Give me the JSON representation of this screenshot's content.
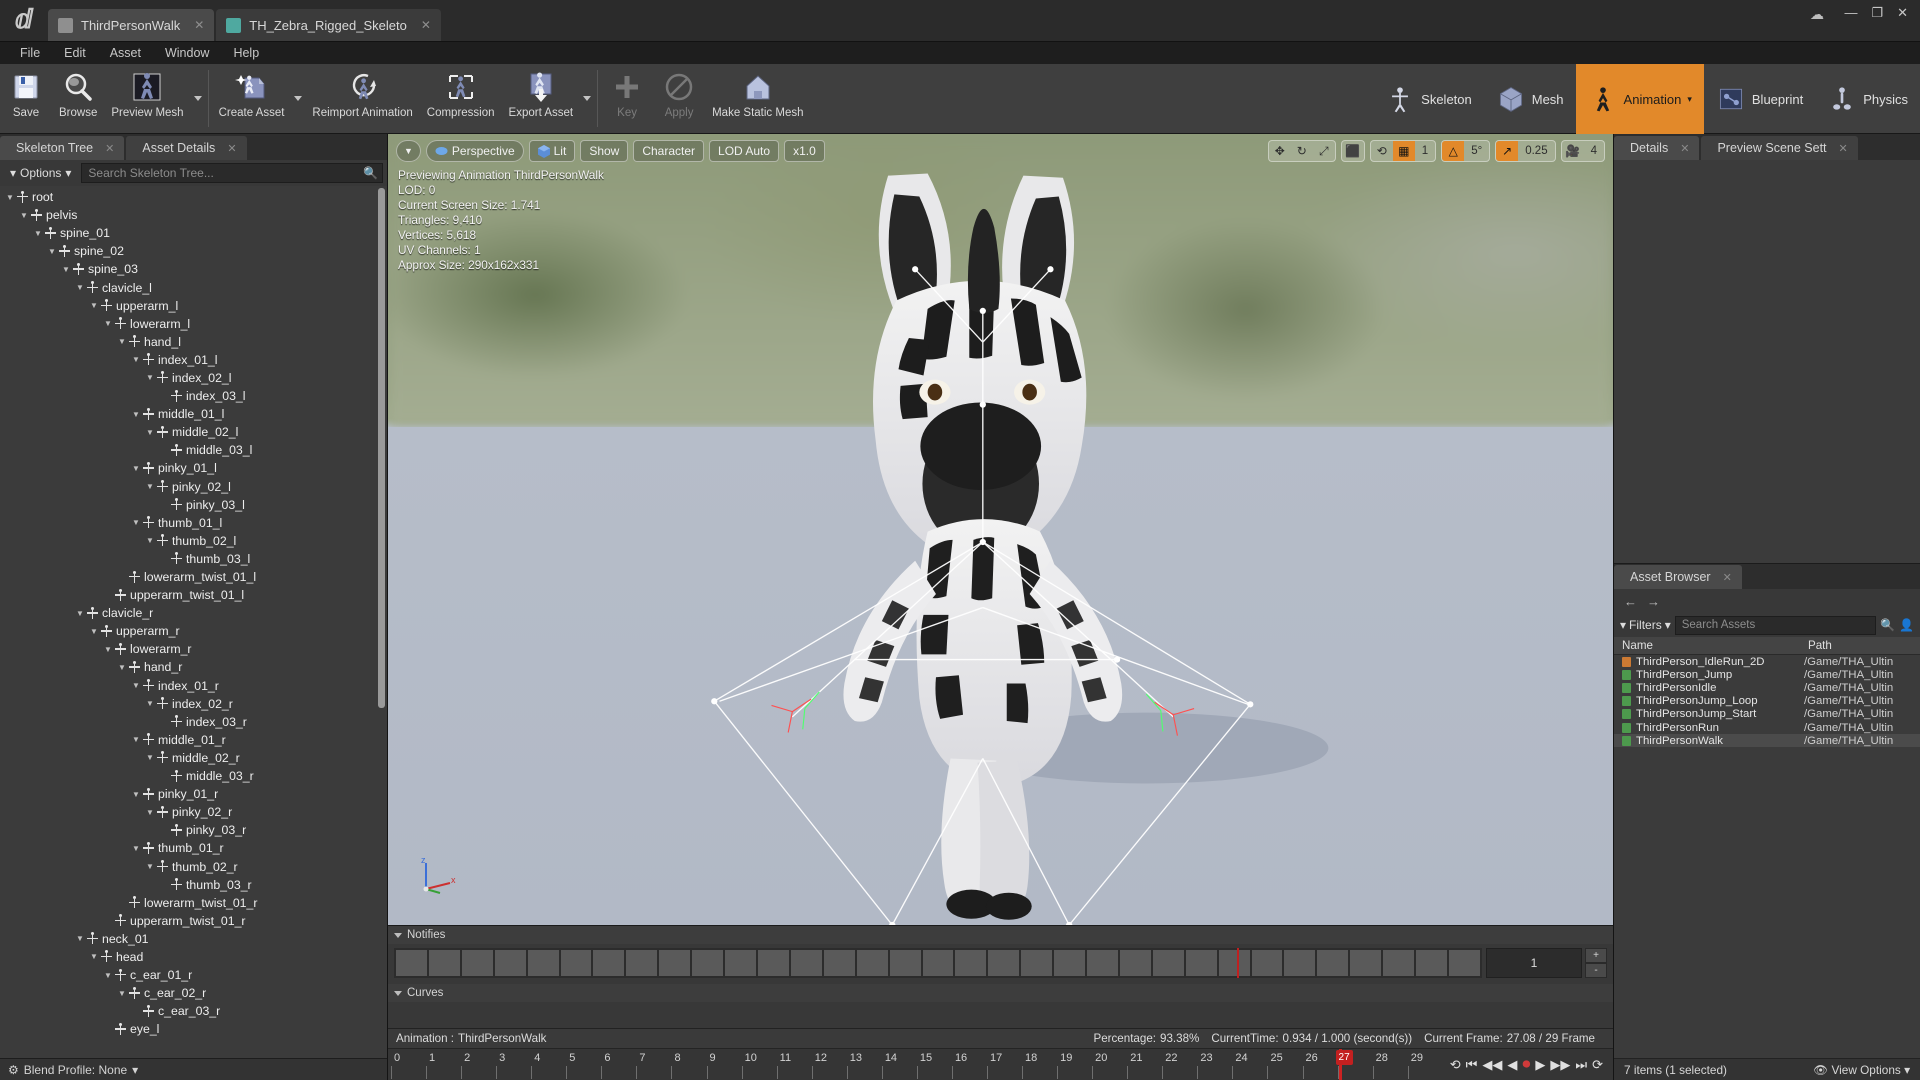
{
  "window": {
    "tabs": [
      {
        "label": "ThirdPersonWalk",
        "active": true,
        "icon": "animation-asset-icon",
        "color": "#8f8f8f"
      },
      {
        "label": "TH_Zebra_Rigged_Skeleto",
        "active": false,
        "icon": "skeleton-asset-icon",
        "color": "#4fa9a0"
      }
    ],
    "controls": {
      "minimize": "—",
      "maximize": "❐",
      "close": "✕",
      "cloud": "☁"
    }
  },
  "menubar": [
    "File",
    "Edit",
    "Asset",
    "Window",
    "Help"
  ],
  "toolbar": {
    "groups": [
      {
        "buttons": [
          {
            "label": "Save",
            "icon": "save-icon",
            "caret": false,
            "disabled": false
          },
          {
            "label": "Browse",
            "icon": "browse-magnifier-icon",
            "caret": false,
            "disabled": false
          },
          {
            "label": "Preview Mesh",
            "icon": "preview-mesh-icon",
            "caret": true,
            "disabled": false
          }
        ]
      },
      {
        "buttons": [
          {
            "label": "Create Asset",
            "icon": "create-asset-icon",
            "caret": true,
            "disabled": false
          },
          {
            "label": "Reimport Animation",
            "icon": "reimport-animation-icon",
            "caret": false,
            "disabled": false
          },
          {
            "label": "Compression",
            "icon": "compression-icon",
            "caret": false,
            "disabled": false
          },
          {
            "label": "Export Asset",
            "icon": "export-asset-icon",
            "caret": true,
            "disabled": false
          }
        ]
      },
      {
        "buttons": [
          {
            "label": "Key",
            "icon": "key-plus-icon",
            "caret": false,
            "disabled": true
          },
          {
            "label": "Apply",
            "icon": "apply-icon",
            "caret": false,
            "disabled": true
          },
          {
            "label": "Make Static Mesh",
            "icon": "make-static-mesh-icon",
            "caret": false,
            "disabled": false
          }
        ]
      }
    ],
    "modes": [
      {
        "label": "Skeleton",
        "selected": false,
        "caret": false,
        "icon": "skeleton-mode-icon"
      },
      {
        "label": "Mesh",
        "selected": false,
        "caret": false,
        "icon": "mesh-mode-icon"
      },
      {
        "label": "Animation",
        "selected": true,
        "caret": true,
        "icon": "animation-mode-icon"
      },
      {
        "label": "Blueprint",
        "selected": false,
        "caret": false,
        "icon": "blueprint-mode-icon"
      },
      {
        "label": "Physics",
        "selected": false,
        "caret": false,
        "icon": "physics-mode-icon"
      }
    ]
  },
  "left_panel": {
    "tabs": [
      {
        "label": "Skeleton Tree",
        "active": true,
        "icon": "skeleton-tree-icon"
      },
      {
        "label": "Asset Details",
        "active": false,
        "icon": "asset-details-icon"
      }
    ],
    "options_label": "Options",
    "search_placeholder": "Search Skeleton Tree...",
    "blend_profile_label": "Blend Profile: None",
    "bones": [
      {
        "name": "root",
        "depth": 0,
        "expandable": true
      },
      {
        "name": "pelvis",
        "depth": 1,
        "expandable": true
      },
      {
        "name": "spine_01",
        "depth": 2,
        "expandable": true
      },
      {
        "name": "spine_02",
        "depth": 3,
        "expandable": true
      },
      {
        "name": "spine_03",
        "depth": 4,
        "expandable": true
      },
      {
        "name": "clavicle_l",
        "depth": 5,
        "expandable": true
      },
      {
        "name": "upperarm_l",
        "depth": 6,
        "expandable": true
      },
      {
        "name": "lowerarm_l",
        "depth": 7,
        "expandable": true
      },
      {
        "name": "hand_l",
        "depth": 8,
        "expandable": true
      },
      {
        "name": "index_01_l",
        "depth": 9,
        "expandable": true
      },
      {
        "name": "index_02_l",
        "depth": 10,
        "expandable": true
      },
      {
        "name": "index_03_l",
        "depth": 11,
        "expandable": false
      },
      {
        "name": "middle_01_l",
        "depth": 9,
        "expandable": true
      },
      {
        "name": "middle_02_l",
        "depth": 10,
        "expandable": true
      },
      {
        "name": "middle_03_l",
        "depth": 11,
        "expandable": false
      },
      {
        "name": "pinky_01_l",
        "depth": 9,
        "expandable": true
      },
      {
        "name": "pinky_02_l",
        "depth": 10,
        "expandable": true
      },
      {
        "name": "pinky_03_l",
        "depth": 11,
        "expandable": false
      },
      {
        "name": "thumb_01_l",
        "depth": 9,
        "expandable": true
      },
      {
        "name": "thumb_02_l",
        "depth": 10,
        "expandable": true
      },
      {
        "name": "thumb_03_l",
        "depth": 11,
        "expandable": false
      },
      {
        "name": "lowerarm_twist_01_l",
        "depth": 8,
        "expandable": false
      },
      {
        "name": "upperarm_twist_01_l",
        "depth": 7,
        "expandable": false
      },
      {
        "name": "clavicle_r",
        "depth": 5,
        "expandable": true
      },
      {
        "name": "upperarm_r",
        "depth": 6,
        "expandable": true
      },
      {
        "name": "lowerarm_r",
        "depth": 7,
        "expandable": true
      },
      {
        "name": "hand_r",
        "depth": 8,
        "expandable": true
      },
      {
        "name": "index_01_r",
        "depth": 9,
        "expandable": true
      },
      {
        "name": "index_02_r",
        "depth": 10,
        "expandable": true
      },
      {
        "name": "index_03_r",
        "depth": 11,
        "expandable": false
      },
      {
        "name": "middle_01_r",
        "depth": 9,
        "expandable": true
      },
      {
        "name": "middle_02_r",
        "depth": 10,
        "expandable": true
      },
      {
        "name": "middle_03_r",
        "depth": 11,
        "expandable": false
      },
      {
        "name": "pinky_01_r",
        "depth": 9,
        "expandable": true
      },
      {
        "name": "pinky_02_r",
        "depth": 10,
        "expandable": true
      },
      {
        "name": "pinky_03_r",
        "depth": 11,
        "expandable": false
      },
      {
        "name": "thumb_01_r",
        "depth": 9,
        "expandable": true
      },
      {
        "name": "thumb_02_r",
        "depth": 10,
        "expandable": true
      },
      {
        "name": "thumb_03_r",
        "depth": 11,
        "expandable": false
      },
      {
        "name": "lowerarm_twist_01_r",
        "depth": 8,
        "expandable": false
      },
      {
        "name": "upperarm_twist_01_r",
        "depth": 7,
        "expandable": false
      },
      {
        "name": "neck_01",
        "depth": 5,
        "expandable": true
      },
      {
        "name": "head",
        "depth": 6,
        "expandable": true
      },
      {
        "name": "c_ear_01_r",
        "depth": 7,
        "expandable": true
      },
      {
        "name": "c_ear_02_r",
        "depth": 8,
        "expandable": true
      },
      {
        "name": "c_ear_03_r",
        "depth": 9,
        "expandable": false
      },
      {
        "name": "eye_l",
        "depth": 7,
        "expandable": false
      }
    ]
  },
  "viewport": {
    "toolbar_left": [
      {
        "label": "Perspective",
        "icon": "perspective-icon"
      },
      {
        "label": "Lit",
        "icon": "lit-cube-icon"
      },
      {
        "label": "Show",
        "icon": ""
      },
      {
        "label": "Character",
        "icon": ""
      },
      {
        "label": "LOD Auto",
        "icon": ""
      },
      {
        "label": "x1.0",
        "icon": "play-speed-icon"
      }
    ],
    "transform_tools": [
      {
        "name": "translate-gizmo-icon",
        "glyph": "✥",
        "on": false
      },
      {
        "name": "rotate-gizmo-icon",
        "glyph": "↻",
        "on": false
      },
      {
        "name": "scale-gizmo-icon",
        "glyph": "⤢",
        "on": false
      }
    ],
    "coord_icon": "world-space-icon",
    "snap_group": [
      {
        "name": "surface-snap-icon",
        "glyph": "⟲",
        "on": false,
        "text": ""
      },
      {
        "name": "grid-snap-icon",
        "glyph": "▦",
        "on": true,
        "text": ""
      },
      {
        "name": "grid-size-value",
        "glyph": "",
        "on": false,
        "text": "1"
      }
    ],
    "rotation_group": [
      {
        "name": "rotation-snap-icon",
        "glyph": "△",
        "on": true,
        "text": ""
      },
      {
        "name": "rotation-snap-value",
        "glyph": "",
        "on": false,
        "text": "5°"
      }
    ],
    "scale_group": [
      {
        "name": "scale-snap-icon",
        "glyph": "↗",
        "on": true,
        "text": ""
      },
      {
        "name": "scale-snap-value",
        "glyph": "",
        "on": false,
        "text": "0.25"
      }
    ],
    "camera_group": [
      {
        "name": "camera-speed-icon",
        "glyph": "🎥",
        "on": false,
        "text": ""
      },
      {
        "name": "camera-speed-value",
        "glyph": "",
        "on": false,
        "text": "4"
      }
    ],
    "stats": [
      "Previewing Animation ThirdPersonWalk",
      "LOD: 0",
      "Current Screen Size: 1.741",
      "Triangles: 9,410",
      "Vertices: 5,618",
      "UV Channels: 1",
      "Approx Size: 290x162x331"
    ],
    "axis": {
      "z": "z",
      "y": "y",
      "x": "x"
    }
  },
  "bottom": {
    "notifies_label": "Notifies",
    "curves_label": "Curves",
    "notify_value": "1",
    "notify_plus": "+",
    "notify_minus": "-",
    "notify_track_cells": 33,
    "notify_playhead_pct": 77.5,
    "animation_prefix": "Animation :",
    "animation_name": "ThirdPersonWalk",
    "percentage_label": "Percentage:",
    "percentage_value": "93.38%",
    "currenttime_label": "CurrentTime:",
    "currenttime_value": "0.934 / 1.000 (second(s))",
    "currentframe_label": "Current Frame:",
    "currentframe_value": "27.08 / 29 Frame",
    "ticks": [
      "0",
      "1",
      "2",
      "3",
      "4",
      "5",
      "6",
      "7",
      "8",
      "9",
      "10",
      "11",
      "12",
      "13",
      "14",
      "15",
      "16",
      "17",
      "18",
      "19",
      "20",
      "21",
      "22",
      "23",
      "24",
      "25",
      "26",
      "27",
      "28",
      "29"
    ],
    "playhead_frame": "27",
    "transport": [
      {
        "name": "loop-button",
        "glyph": "⟲"
      },
      {
        "name": "skip-to-start-button",
        "glyph": "⏮"
      },
      {
        "name": "step-backward-button",
        "glyph": "◀◀"
      },
      {
        "name": "play-reverse-button",
        "glyph": "◀"
      },
      {
        "name": "record-button",
        "glyph": "⏺"
      },
      {
        "name": "play-button",
        "glyph": "▶"
      },
      {
        "name": "step-forward-button",
        "glyph": "▶▶"
      },
      {
        "name": "skip-to-end-button",
        "glyph": "⏭"
      },
      {
        "name": "loop-toggle-button",
        "glyph": "⟳"
      }
    ]
  },
  "right_panel": {
    "tabs": [
      {
        "label": "Details",
        "active": true,
        "icon": "details-icon"
      },
      {
        "label": "Preview Scene Sett",
        "active": false,
        "icon": "preview-scene-icon"
      }
    ],
    "asset_browser": {
      "tab_label": "Asset Browser",
      "tab_icon": "asset-browser-icon",
      "back_glyph": "←",
      "forward_glyph": "→",
      "filters_label": "Filters",
      "search_placeholder": "Search Assets",
      "search_icon": "search-icon",
      "user_icon": "user-icon",
      "columns": [
        "Name",
        "Path"
      ],
      "rows": [
        {
          "name": "ThirdPerson_IdleRun_2D",
          "path": "/Game/THA_Ultin",
          "color": "#cc7a33",
          "selected": false
        },
        {
          "name": "ThirdPerson_Jump",
          "path": "/Game/THA_Ultin",
          "color": "#4d9a4d",
          "selected": false
        },
        {
          "name": "ThirdPersonIdle",
          "path": "/Game/THA_Ultin",
          "color": "#4d9a4d",
          "selected": false
        },
        {
          "name": "ThirdPersonJump_Loop",
          "path": "/Game/THA_Ultin",
          "color": "#4d9a4d",
          "selected": false
        },
        {
          "name": "ThirdPersonJump_Start",
          "path": "/Game/THA_Ultin",
          "color": "#4d9a4d",
          "selected": false
        },
        {
          "name": "ThirdPersonRun",
          "path": "/Game/THA_Ultin",
          "color": "#4d9a4d",
          "selected": false
        },
        {
          "name": "ThirdPersonWalk",
          "path": "/Game/THA_Ultin",
          "color": "#4d9a4d",
          "selected": true
        }
      ],
      "status_left": "7 items (1 selected)",
      "status_right": "View Options",
      "status_right_icon": "eye-icon"
    }
  },
  "colors": {
    "accent": "#e2892a",
    "panel": "#383838",
    "panel_dark": "#2b2b2b",
    "text": "#d6d6d6",
    "playhead": "#cc2222"
  }
}
